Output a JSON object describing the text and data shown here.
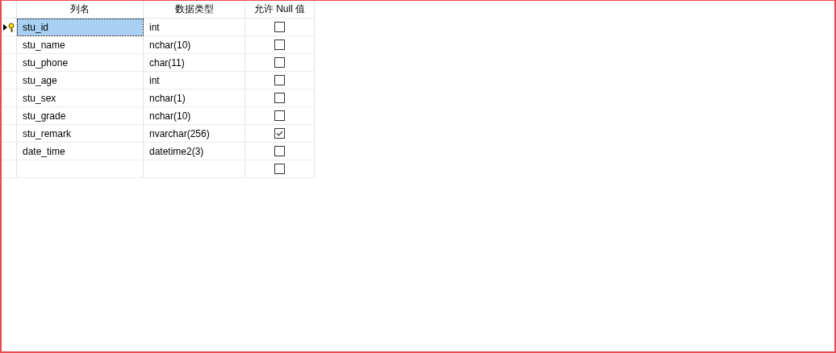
{
  "table": {
    "columns": [
      "列名",
      "数据类型",
      "允许 Null 值"
    ],
    "rows": [
      {
        "name": "stu_id",
        "type": "int",
        "allow_null": false,
        "primary_key": true,
        "current": true,
        "selected": true
      },
      {
        "name": "stu_name",
        "type": "nchar(10)",
        "allow_null": false,
        "primary_key": false,
        "current": false,
        "selected": false
      },
      {
        "name": "stu_phone",
        "type": "char(11)",
        "allow_null": false,
        "primary_key": false,
        "current": false,
        "selected": false
      },
      {
        "name": "stu_age",
        "type": "int",
        "allow_null": false,
        "primary_key": false,
        "current": false,
        "selected": false
      },
      {
        "name": "stu_sex",
        "type": "nchar(1)",
        "allow_null": false,
        "primary_key": false,
        "current": false,
        "selected": false
      },
      {
        "name": "stu_grade",
        "type": "nchar(10)",
        "allow_null": false,
        "primary_key": false,
        "current": false,
        "selected": false
      },
      {
        "name": "stu_remark",
        "type": "nvarchar(256)",
        "allow_null": true,
        "primary_key": false,
        "current": false,
        "selected": false
      },
      {
        "name": "date_time",
        "type": "datetime2(3)",
        "allow_null": false,
        "primary_key": false,
        "current": false,
        "selected": false
      },
      {
        "allow_null": false,
        "primary_key": false,
        "current": false,
        "selected": false
      }
    ]
  }
}
